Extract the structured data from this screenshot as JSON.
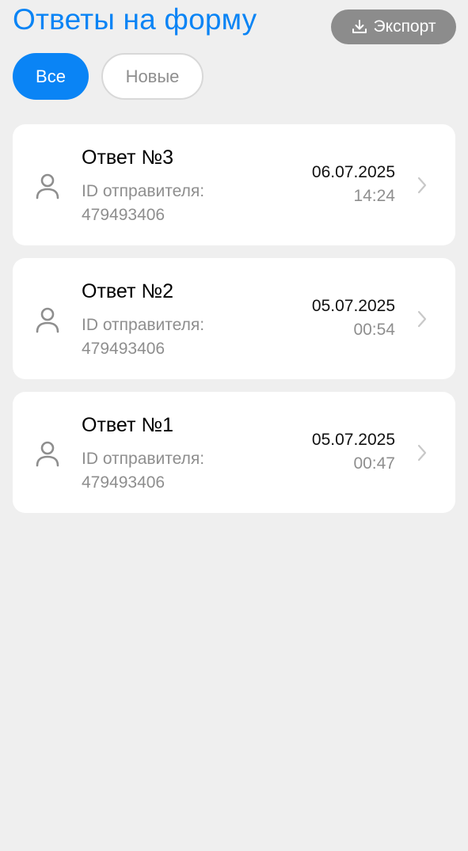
{
  "header": {
    "title": "Ответы на форму",
    "export_label": "Экспорт",
    "export_icon": "download-icon"
  },
  "filters": [
    {
      "label": "Все",
      "active": true
    },
    {
      "label": "Новые",
      "active": false
    }
  ],
  "responses": [
    {
      "title": "Ответ №3",
      "sender_label": "ID отправителя:",
      "sender_id": "479493406",
      "date": "06.07.2025",
      "time": "14:24"
    },
    {
      "title": "Ответ №2",
      "sender_label": "ID отправителя:",
      "sender_id": "479493406",
      "date": "05.07.2025",
      "time": "00:54"
    },
    {
      "title": "Ответ №1",
      "sender_label": "ID отправителя:",
      "sender_id": "479493406",
      "date": "05.07.2025",
      "time": "00:47"
    }
  ],
  "colors": {
    "accent": "#0a84f5",
    "background": "#efefef",
    "export_button": "#8c8c8c",
    "secondary_text": "#8e8e8e"
  }
}
